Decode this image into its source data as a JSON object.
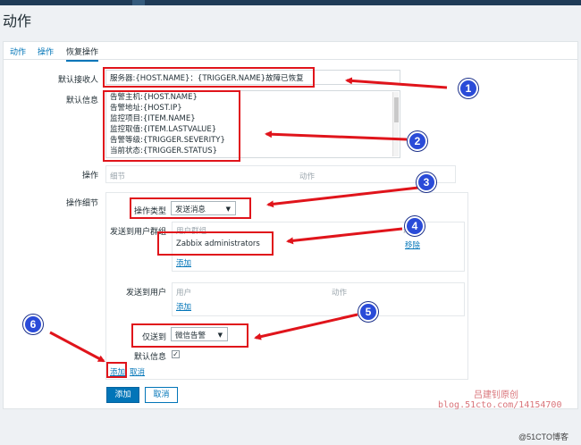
{
  "page": {
    "title": "动作"
  },
  "tabs": [
    {
      "label": "动作"
    },
    {
      "label": "操作"
    },
    {
      "label": "恢复操作"
    }
  ],
  "form": {
    "default_recipient_label": "默认接收人",
    "default_recipient_value": "服务器:{HOST.NAME}：{TRIGGER.NAME}故障已恢复",
    "default_message_label": "默认信息",
    "default_message_lines": [
      "告警主机:{HOST.NAME}",
      "告警地址:{HOST.IP}",
      "监控项目:{ITEM.NAME}",
      "监控取值:{ITEM.LASTVALUE}",
      "告警等级:{TRIGGER.SEVERITY}",
      "当前状态:{TRIGGER.STATUS}"
    ],
    "operations_label": "操作",
    "operations_col_detail": "细节",
    "operations_col_action": "动作",
    "op_details_label": "操作细节",
    "op_type_label": "操作类型",
    "op_type_value": "发送消息",
    "send_groups_label": "发送到用户群组",
    "send_groups_col": "用户群组",
    "send_groups_col_action": "动作",
    "group_value": "Zabbix administrators",
    "remove_link": "移除",
    "add_group_link": "添加",
    "send_users_label": "发送到用户",
    "send_users_col": "用户",
    "send_users_col_action": "动作",
    "add_user_link": "添加",
    "send_only_label": "仅送到",
    "send_only_value": "微信告警",
    "default_msg_check_label": "默认信息",
    "add_op_link": "添加",
    "cancel_op_link": "取消",
    "submit_button": "添加",
    "cancel_button": "取消"
  },
  "badges": [
    "1",
    "2",
    "3",
    "4",
    "5",
    "6"
  ],
  "watermark": {
    "author": "吕建钊原创",
    "blog": "blog.51cto.com/14154700",
    "site": "@51CTO博客"
  },
  "colors": {
    "accent": "#0275b8",
    "highlight": "#e0141b",
    "badge": "#2a4bd8"
  }
}
